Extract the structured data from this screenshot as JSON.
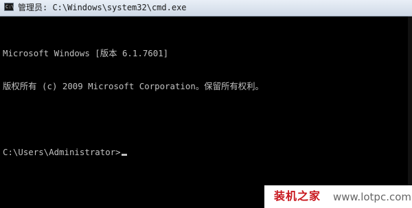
{
  "window": {
    "title": "管理员: C:\\Windows\\system32\\cmd.exe",
    "icon_label": "C:\\",
    "icon": "cmd-icon"
  },
  "console": {
    "lines": [
      "Microsoft Windows [版本 6.1.7601]",
      "版权所有 (c) 2009 Microsoft Corporation。保留所有权利。",
      "",
      "C:\\Users\\Administrator>"
    ]
  },
  "watermark": {
    "text": "装机之家",
    "url": "www.lotpc.com"
  },
  "colors": {
    "console_background": "#000000",
    "console_text": "#c0c0c0",
    "watermark_text": "#c8161d"
  }
}
